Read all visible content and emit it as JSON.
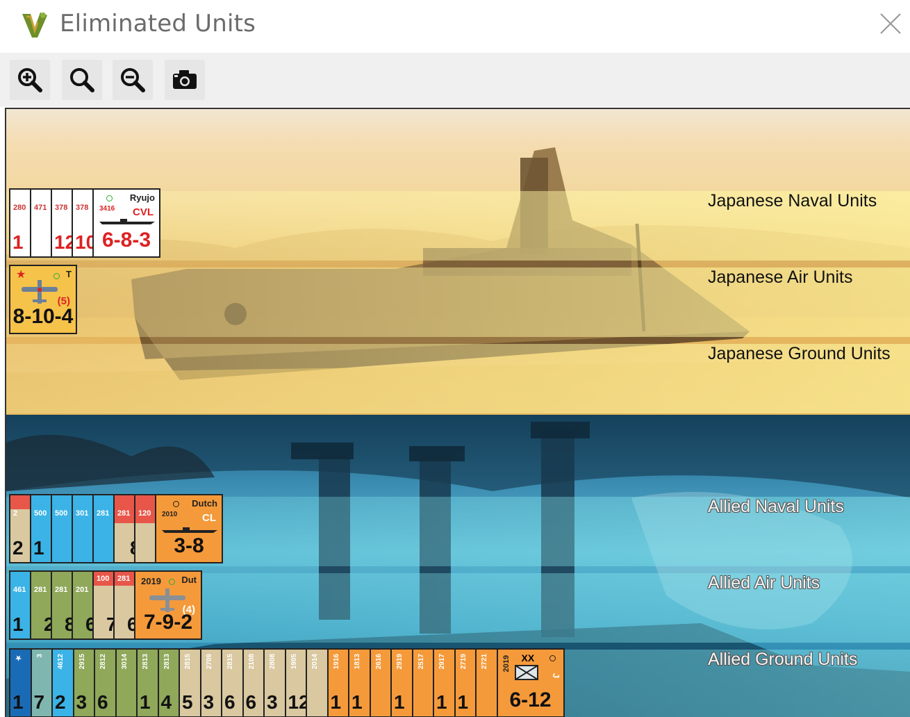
{
  "window": {
    "title": "Eliminated Units",
    "app_icon": "vassal-logo-icon",
    "close_icon": "close-icon"
  },
  "toolbar": {
    "buttons": [
      {
        "name": "zoom-in",
        "icon": "zoom-in-icon"
      },
      {
        "name": "zoom-reset",
        "icon": "zoom-icon"
      },
      {
        "name": "zoom-out",
        "icon": "zoom-out-icon"
      },
      {
        "name": "screenshot",
        "icon": "camera-icon"
      }
    ]
  },
  "sections": {
    "japanese_naval": "Japanese Naval Units",
    "japanese_air": "Japanese Air Units",
    "japanese_ground": "Japanese Ground Units",
    "allied_naval": "Allied Naval Units",
    "allied_air": "Allied Air Units",
    "allied_ground": "Allied Ground Units"
  },
  "colors": {
    "japanese_counter": "#ffffff",
    "japanese_air_counter": "#f5c24a",
    "allied_orange": "#f59a3a",
    "allied_blue": "#3bb3e6",
    "allied_red": "#e8564a",
    "allied_tan": "#d9c8a0",
    "allied_green": "#8fa85a"
  },
  "japanese_naval_stack": {
    "under": [
      {
        "code": "280",
        "num": "1"
      },
      {
        "code": "471",
        "num": ""
      },
      {
        "code": "378",
        "num": "12"
      },
      {
        "code": "378",
        "num": "10"
      }
    ],
    "top": {
      "name": "Ryujo",
      "code": "3416",
      "type": "CVL",
      "stat": "6-8-3"
    }
  },
  "japanese_air_stack": {
    "top": {
      "marker": "T",
      "range": "(5)",
      "stat": "8-10-4"
    }
  },
  "allied_naval_stack": {
    "under": [
      {
        "num": "2",
        "code": "2",
        "color": "tan"
      },
      {
        "num": "1",
        "code": "500",
        "color": "blue"
      },
      {
        "num": "",
        "code": "500",
        "color": "blue"
      },
      {
        "num": "",
        "code": "301",
        "color": "blue"
      },
      {
        "num": "",
        "code": "281",
        "color": "blue"
      },
      {
        "num": "8",
        "code": "281",
        "color": "red"
      },
      {
        "num": "",
        "code": "120",
        "color": "red"
      }
    ],
    "top": {
      "name": "Dutch",
      "code": "2010",
      "type": "CL",
      "stat": "3-8"
    }
  },
  "allied_air_stack": {
    "under": [
      {
        "num": "1",
        "code": "461",
        "color": "blue"
      },
      {
        "num": "2",
        "code": "281",
        "color": "green"
      },
      {
        "num": "8",
        "code": "281",
        "color": "green"
      },
      {
        "num": "6",
        "code": "201",
        "color": "green"
      },
      {
        "num": "7",
        "code": "100",
        "color": "red"
      },
      {
        "num": "6",
        "code": "281",
        "color": "red"
      }
    ],
    "top": {
      "name": "Dut",
      "code": "2019",
      "range": "(4)",
      "stat": "7-9-2"
    }
  },
  "allied_ground_stack": {
    "under": [
      {
        "num": "1",
        "code": "★",
        "color": "navy"
      },
      {
        "num": "7",
        "code": "3",
        "color": "teal"
      },
      {
        "num": "2",
        "code": "4612",
        "color": "blue"
      },
      {
        "num": "3",
        "code": "2915",
        "color": "green"
      },
      {
        "num": "6",
        "code": "2812",
        "color": "green"
      },
      {
        "num": "",
        "code": "3014",
        "color": "green"
      },
      {
        "num": "1",
        "code": "2813",
        "color": "green"
      },
      {
        "num": "4",
        "code": "2813",
        "color": "green"
      },
      {
        "num": "5",
        "code": "2815",
        "color": "tan"
      },
      {
        "num": "3",
        "code": "2709",
        "color": "tan"
      },
      {
        "num": "6",
        "code": "2815",
        "color": "tan"
      },
      {
        "num": "6",
        "code": "2108",
        "color": "tan"
      },
      {
        "num": "3",
        "code": "2808",
        "color": "tan"
      },
      {
        "num": "12",
        "code": "1905",
        "color": "tan"
      },
      {
        "num": "",
        "code": "2014",
        "color": "tan"
      },
      {
        "num": "1",
        "code": "1916",
        "color": "orange"
      },
      {
        "num": "1",
        "code": "1813",
        "color": "orange"
      },
      {
        "num": "",
        "code": "2616",
        "color": "orange"
      },
      {
        "num": "1",
        "code": "2919",
        "color": "orange"
      },
      {
        "num": "",
        "code": "2517",
        "color": "orange"
      },
      {
        "num": "1",
        "code": "2917",
        "color": "orange"
      },
      {
        "num": "1",
        "code": "2719",
        "color": "orange"
      },
      {
        "num": "",
        "code": "2721",
        "color": "orange"
      }
    ],
    "top": {
      "code": "2019",
      "size": "XX",
      "side": "J",
      "stat": "6-12"
    }
  }
}
